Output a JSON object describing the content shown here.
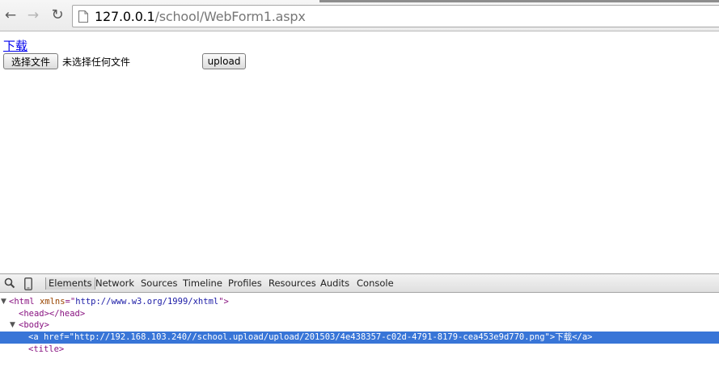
{
  "browser": {
    "url_host": "127.0.0.1",
    "url_path": "/school/WebForm1.aspx"
  },
  "page": {
    "download_link": "下载",
    "choose_file_button": "选择文件",
    "no_file_text": "未选择任何文件",
    "upload_button": "upload"
  },
  "devtools": {
    "tabs": [
      "Elements",
      "Network",
      "Sources",
      "Timeline",
      "Profiles",
      "Resources",
      "Audits",
      "Console"
    ],
    "active_tab": "Elements",
    "dom": {
      "line1": {
        "open": "<html",
        "attr": "xmlns",
        "eq": "=\"",
        "value": "http://www.w3.org/1999/xhtml",
        "close": "\">"
      },
      "line2": "<head></head>",
      "line3": "<body>",
      "line4": {
        "open": "<a",
        "attr": "href",
        "eq": "=\"",
        "value": "http://192.168.103.240//school.upload/upload/201503/4e438357-c02d-4791-8179-cea453e9d770.png",
        "close": "\">",
        "text": "下载",
        "end": "</a>"
      },
      "line5": "<title>"
    }
  },
  "colors": {
    "selection": "#3875d7",
    "link": "#0000ee",
    "tag": "#881280",
    "attribute": "#994500",
    "attribute_value": "#1a1aa6"
  }
}
